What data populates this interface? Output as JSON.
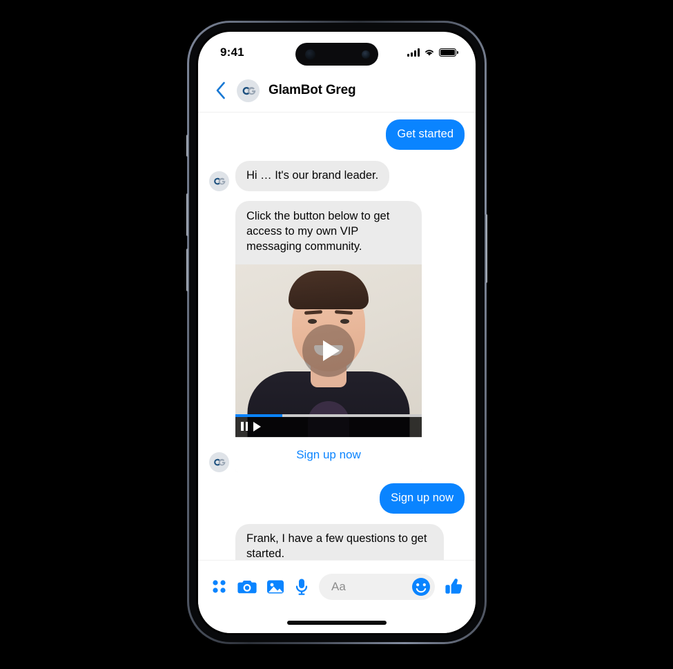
{
  "device": {
    "status_bar": {
      "time": "9:41",
      "signal_icon": "cellular-signal-icon",
      "wifi_icon": "wifi-icon",
      "battery_icon": "battery-icon"
    }
  },
  "header": {
    "back_icon": "chevron-left-icon",
    "avatar_icon": "glambot-avatar-icon",
    "title": "GlamBot Greg"
  },
  "colors": {
    "accent_blue": "#0A84FF",
    "bubble_gray": "#EBEBEB",
    "text_dark": "#050505"
  },
  "messages": [
    {
      "type": "outgoing_bubble",
      "text": "Get started"
    },
    {
      "type": "incoming_bubble",
      "text": "Hi … It's our brand leader."
    },
    {
      "type": "incoming_card",
      "text": "Click the button below to get access to my own VIP messaging community.",
      "video": {
        "play_icon": "play-button-icon",
        "progress_percent": 25,
        "pause_icon": "pause-icon",
        "play_small_icon": "play-icon"
      },
      "cta_label": "Sign up now"
    },
    {
      "type": "outgoing_bubble",
      "text": "Sign up now"
    },
    {
      "type": "incoming_bubble",
      "text": "Frank, I have a few questions to get started.\nPlease share your email address first - you may see the"
    }
  ],
  "composer": {
    "grid_icon": "four-dot-grid-icon",
    "camera_icon": "camera-icon",
    "photo_icon": "photo-library-icon",
    "mic_icon": "microphone-icon",
    "input_placeholder": "Aa",
    "emoji_icon": "smiley-face-icon",
    "thumbs_up_icon": "thumbs-up-icon"
  }
}
